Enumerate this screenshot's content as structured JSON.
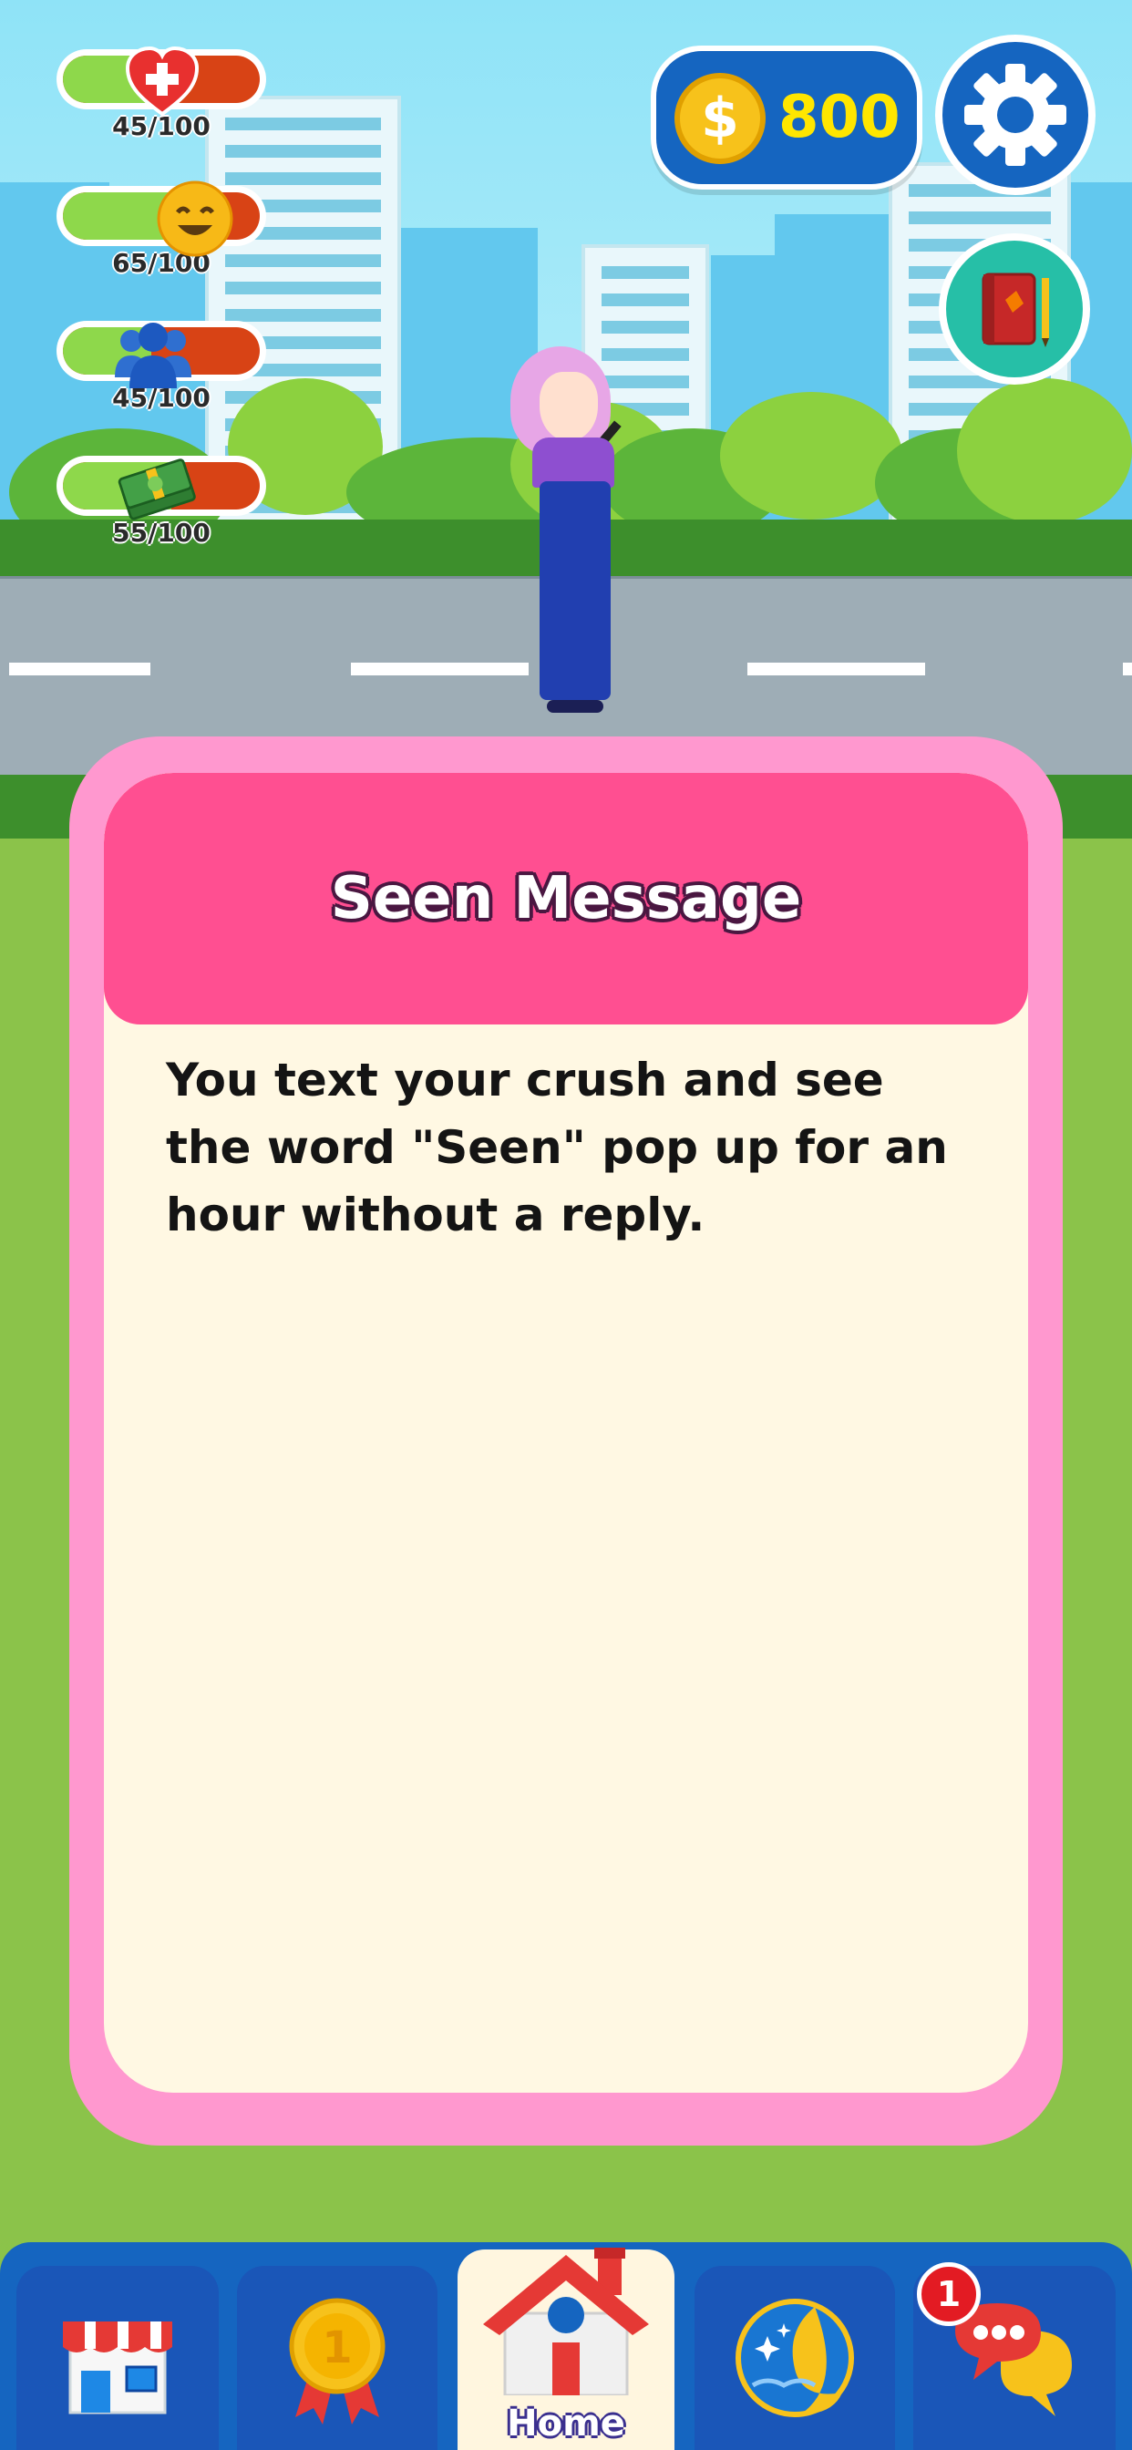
{
  "stats": [
    {
      "name": "health",
      "icon": "heart-plus-icon",
      "value": "45/100",
      "level": 0.45
    },
    {
      "name": "happiness",
      "icon": "smiley-icon",
      "value": "65/100",
      "level": 0.65
    },
    {
      "name": "social",
      "icon": "people-icon",
      "value": "45/100",
      "level": 0.45
    },
    {
      "name": "money",
      "icon": "cash-icon",
      "value": "55/100",
      "level": 0.55
    }
  ],
  "coins": {
    "icon": "dollar-coin-icon",
    "symbol": "$",
    "amount": "800"
  },
  "buttons": {
    "settings_icon": "gear-icon",
    "journal_icon": "notebook-icon"
  },
  "card": {
    "title": "Seen Message",
    "body": "You text your crush and see the word \"Seen\" pop up for an hour without a reply."
  },
  "nav": {
    "tabs": [
      {
        "id": "shop",
        "icon": "shop-icon",
        "label": ""
      },
      {
        "id": "achievements",
        "icon": "medal-icon",
        "label": ""
      },
      {
        "id": "home",
        "icon": "house-icon",
        "label": "Home",
        "active": true
      },
      {
        "id": "sleep",
        "icon": "moon-icon",
        "label": ""
      },
      {
        "id": "messages",
        "icon": "chat-icon",
        "label": "",
        "badge": "1"
      }
    ],
    "medal_number": "1"
  },
  "colors": {
    "accent": "#ff4f91",
    "card_border": "#ff98cf",
    "nav": "#1565c0",
    "bar_fill": "#8ed84b",
    "bar_track": "#d84315"
  }
}
